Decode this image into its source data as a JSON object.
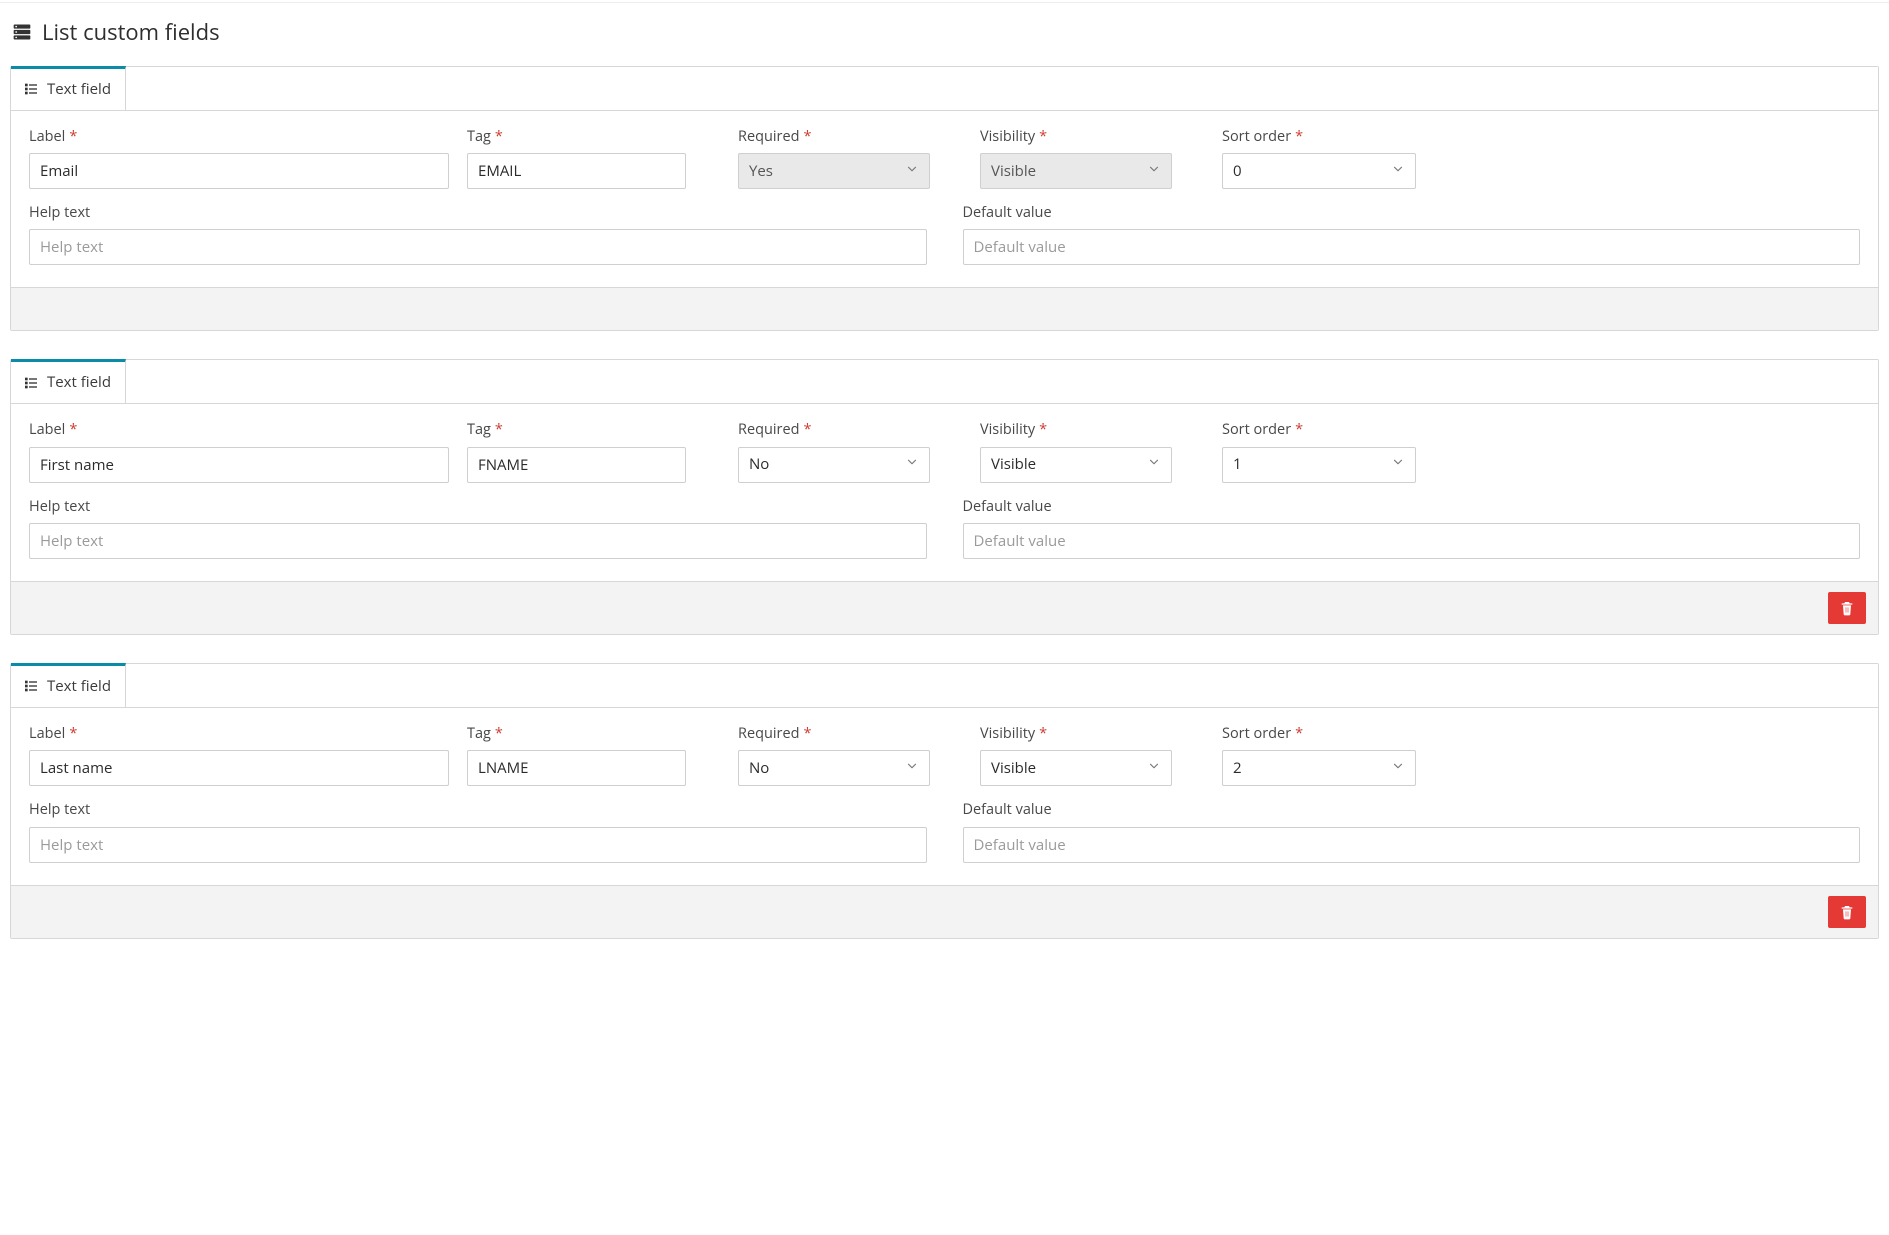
{
  "page": {
    "title": "List custom fields",
    "icon": "server-icon"
  },
  "common": {
    "tab_label": "Text field",
    "labels": {
      "label": "Label",
      "tag": "Tag",
      "required": "Required",
      "visibility": "Visibility",
      "sort_order": "Sort order",
      "help_text": "Help text",
      "default_value": "Default value"
    },
    "placeholders": {
      "help_text": "Help text",
      "default_value": "Default value"
    },
    "required_marker": "*"
  },
  "fields": [
    {
      "label": "Email",
      "tag": "EMAIL",
      "tag_readonly": true,
      "required": "Yes",
      "required_readonly": true,
      "visibility": "Visible",
      "visibility_readonly": true,
      "sort_order": "0",
      "help_text": "",
      "default_value": "",
      "deletable": false
    },
    {
      "label": "First name",
      "tag": "FNAME",
      "tag_readonly": false,
      "required": "No",
      "required_readonly": false,
      "visibility": "Visible",
      "visibility_readonly": false,
      "sort_order": "1",
      "help_text": "",
      "default_value": "",
      "deletable": true
    },
    {
      "label": "Last name",
      "tag": "LNAME",
      "tag_readonly": false,
      "required": "No",
      "required_readonly": false,
      "visibility": "Visible",
      "visibility_readonly": false,
      "sort_order": "2",
      "help_text": "",
      "default_value": "",
      "deletable": true
    }
  ]
}
